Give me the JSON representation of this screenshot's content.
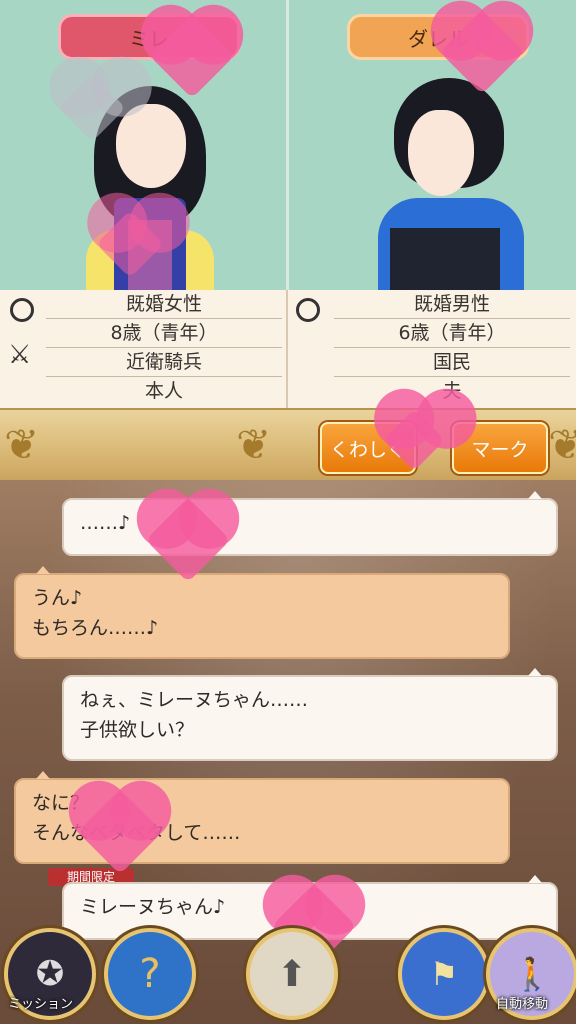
{
  "left": {
    "name": "ミレ",
    "status": "既婚女性",
    "age": "8歳（青年）",
    "job": "近衛騎兵",
    "relation": "本人"
  },
  "right": {
    "name": "ダレル",
    "status": "既婚男性",
    "age": "6歳（青年）",
    "job": "国民",
    "relation": "夫"
  },
  "actions": {
    "details": "くわしく",
    "mark": "マーク"
  },
  "chat": [
    {
      "line1": "……♪",
      "line2": ""
    },
    {
      "line1": "うん♪",
      "line2": "もちろん……♪"
    },
    {
      "line1": "ねぇ、ミレーヌちゃん……",
      "line2": "子供欲しい？"
    },
    {
      "line1": "なに？",
      "line2": "そんなベタベタして……"
    },
    {
      "line1": "ミレーヌちゃん♪",
      "line2": ""
    }
  ],
  "nav": {
    "mission": "ミッション",
    "auto_move": "自動移動",
    "limited_banner": "期間限定"
  },
  "colors": {
    "top_bg": "#a8d6c4",
    "left_tag": "#e0566a",
    "right_tag": "#f1a453",
    "button": "#f08c1e",
    "heart": "#f45c9e"
  }
}
